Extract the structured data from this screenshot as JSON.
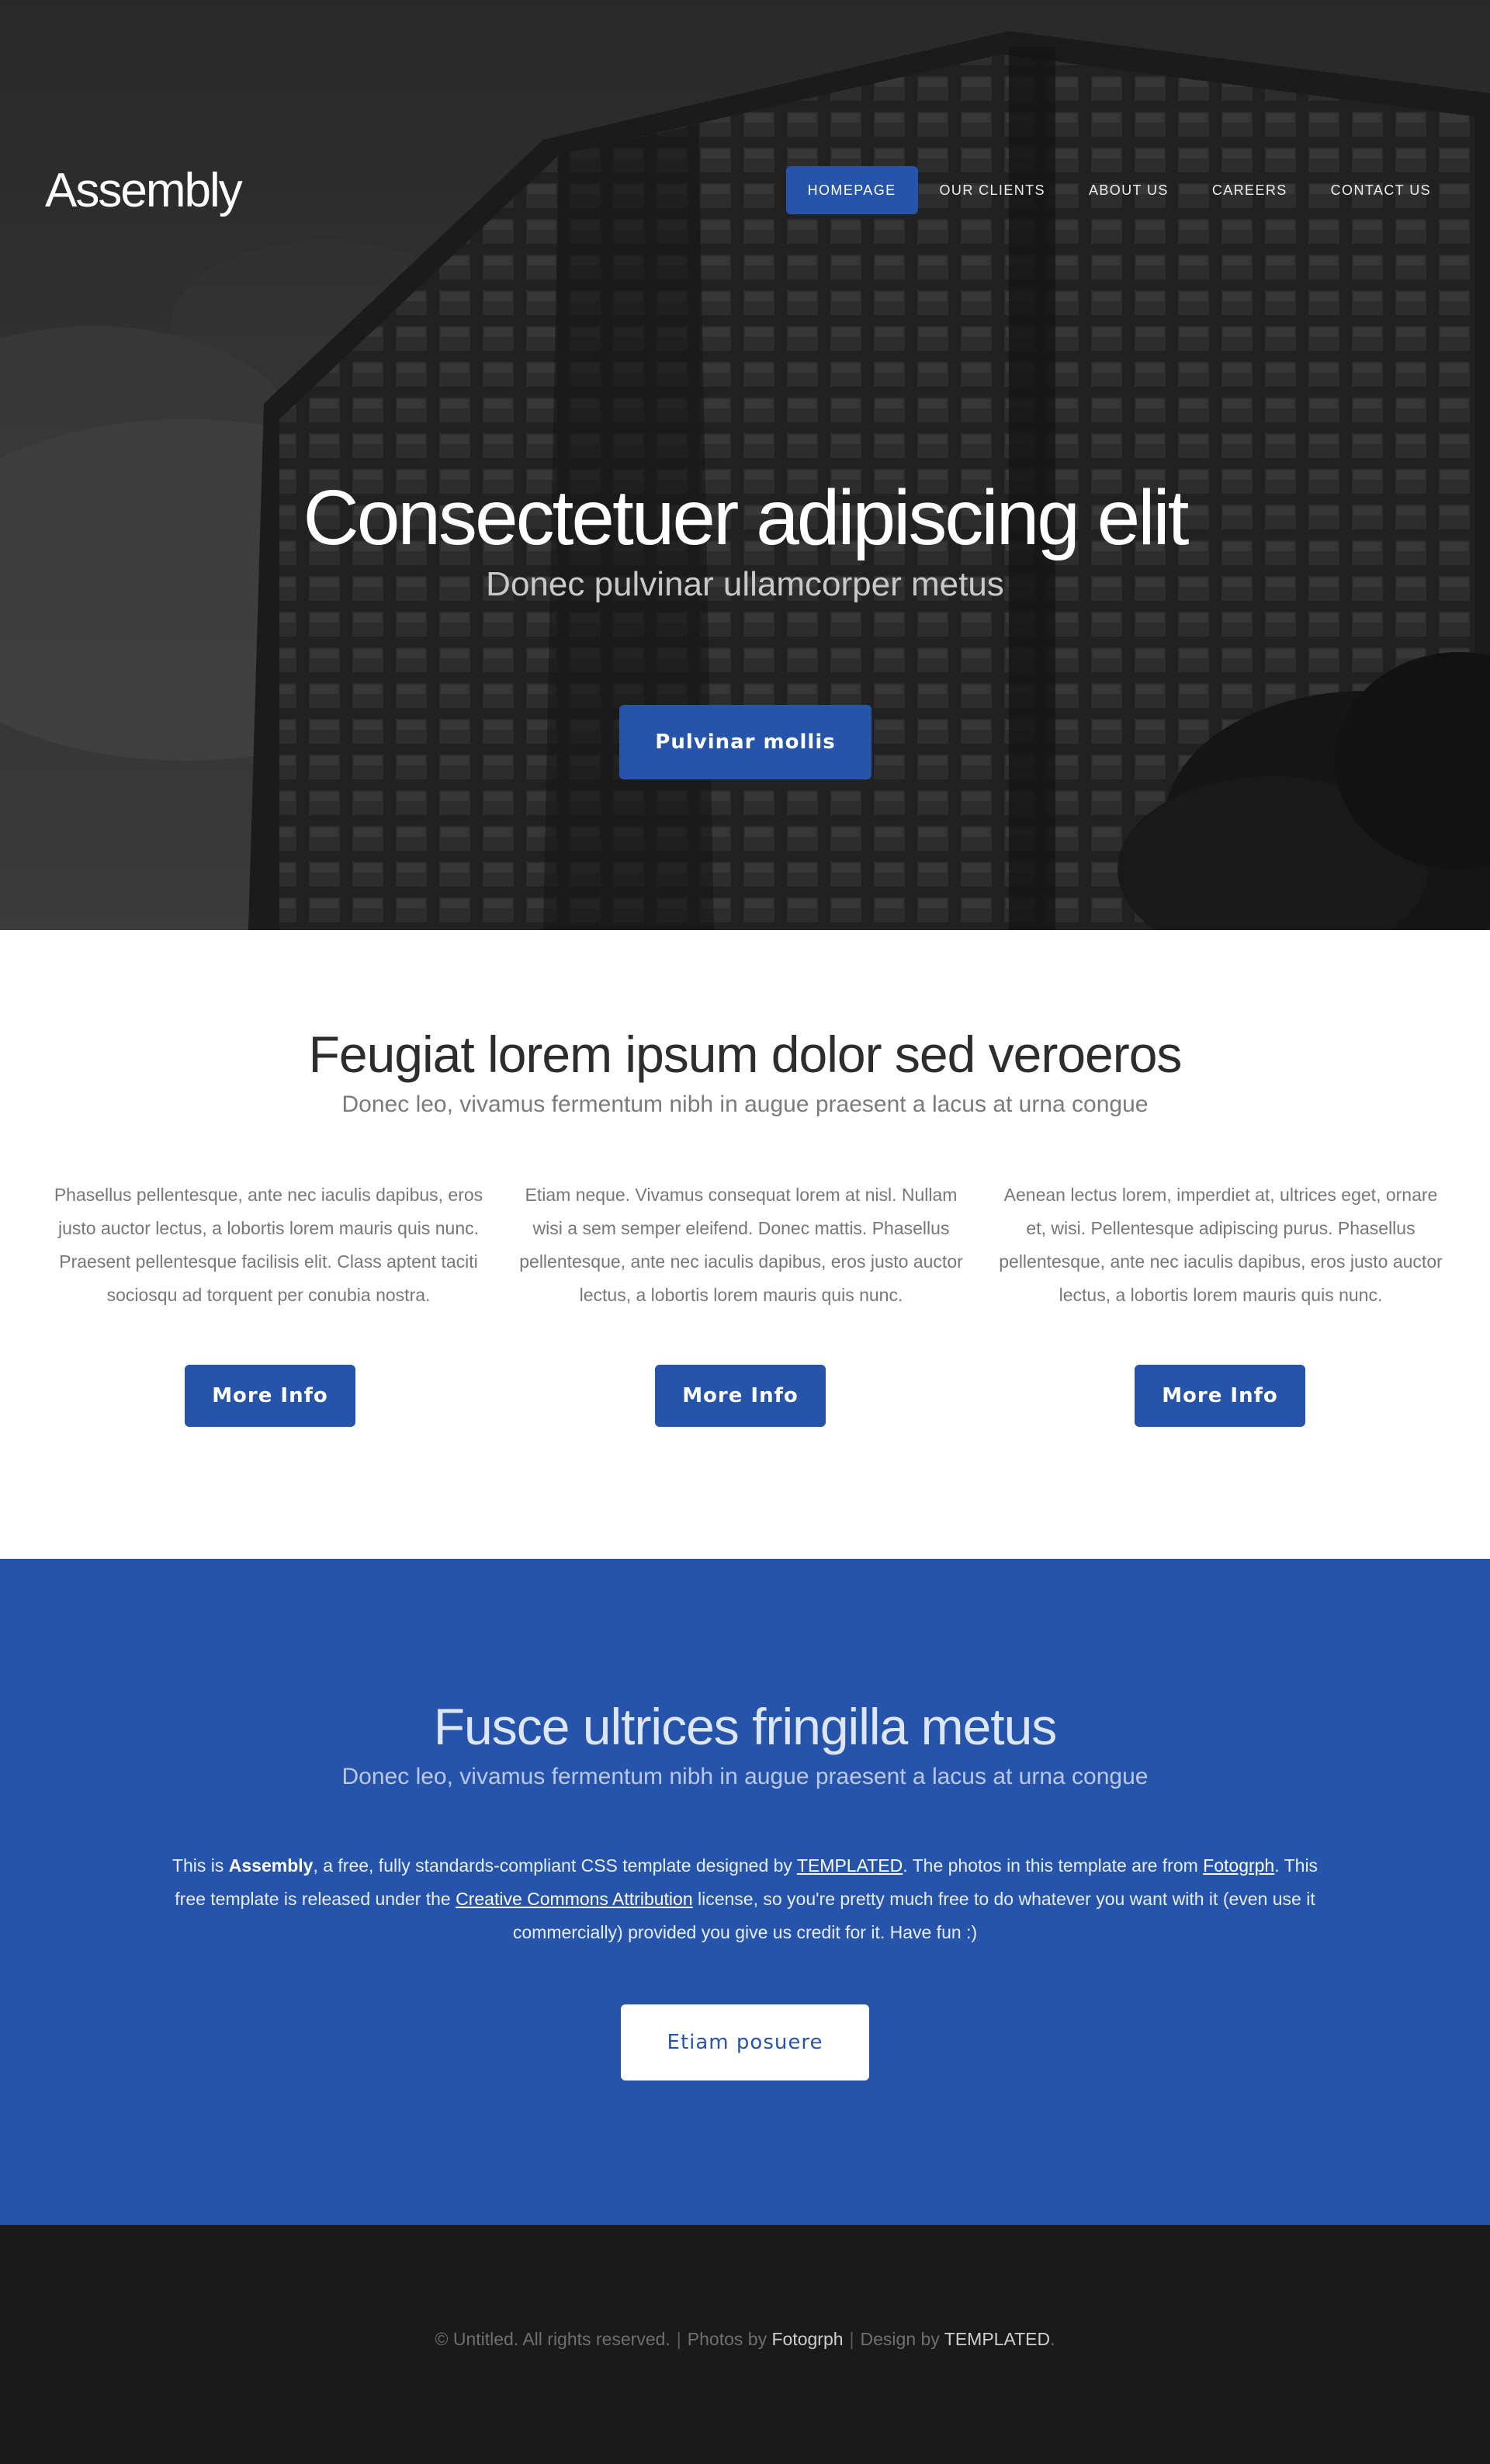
{
  "header": {
    "logo": "Assembly",
    "nav": [
      {
        "label": "HOMEPAGE"
      },
      {
        "label": "OUR CLIENTS"
      },
      {
        "label": "ABOUT US"
      },
      {
        "label": "CAREERS"
      },
      {
        "label": "CONTACT US"
      }
    ]
  },
  "hero": {
    "title": "Consectetuer adipiscing elit",
    "subtitle": "Donec pulvinar ullamcorper metus",
    "button": "Pulvinar mollis"
  },
  "features": {
    "title": "Feugiat lorem ipsum dolor sed veroeros",
    "subtitle": "Donec leo, vivamus fermentum nibh in augue praesent a lacus at urna congue",
    "columns": [
      {
        "text": "Phasellus pellentesque, ante nec iaculis dapibus, eros justo auctor lectus, a lobortis lorem mauris quis nunc. Praesent pellentesque facilisis elit. Class aptent taciti sociosqu ad torquent per conubia nostra.",
        "button": "More Info"
      },
      {
        "text": "Etiam neque. Vivamus consequat lorem at nisl. Nullam wisi a sem semper eleifend. Donec mattis. Phasellus pellentesque, ante nec iaculis dapibus, eros justo auctor lectus, a lobortis lorem mauris quis nunc.",
        "button": "More Info"
      },
      {
        "text": "Aenean lectus lorem, imperdiet at, ultrices eget, ornare et, wisi. Pellentesque adipiscing purus. Phasellus pellentesque, ante nec iaculis dapibus, eros justo auctor lectus, a lobortis lorem mauris quis nunc.",
        "button": "More Info"
      }
    ]
  },
  "cta": {
    "title": "Fusce ultrices fringilla metus",
    "subtitle": "Donec leo, vivamus fermentum nibh in augue praesent a lacus at urna congue",
    "text_1": "This is ",
    "brand": "Assembly",
    "text_2": ", a free, fully standards-compliant CSS template designed by ",
    "link_templated": "TEMPLATED",
    "text_3": ". The photos in this template are from ",
    "link_fotogrph": "Fotogrph",
    "text_4": ". This free template is released under the ",
    "link_license": "Creative Commons Attribution",
    "text_5": " license, so you're pretty much free to do whatever you want with it (even use it commercially) provided you give us credit for it. Have fun :)",
    "button": "Etiam posuere"
  },
  "footer": {
    "copyright": "© Untitled. All rights reserved.",
    "separator": "|",
    "photos_label": "Photos by",
    "photos_link": "Fotogrph",
    "design_label": "Design by",
    "design_link": "TEMPLATED",
    "end": "."
  },
  "colors": {
    "accent": "#2754ab",
    "footer_bg": "#1a1a1a",
    "hero_overlay": "#2a2a2a"
  }
}
